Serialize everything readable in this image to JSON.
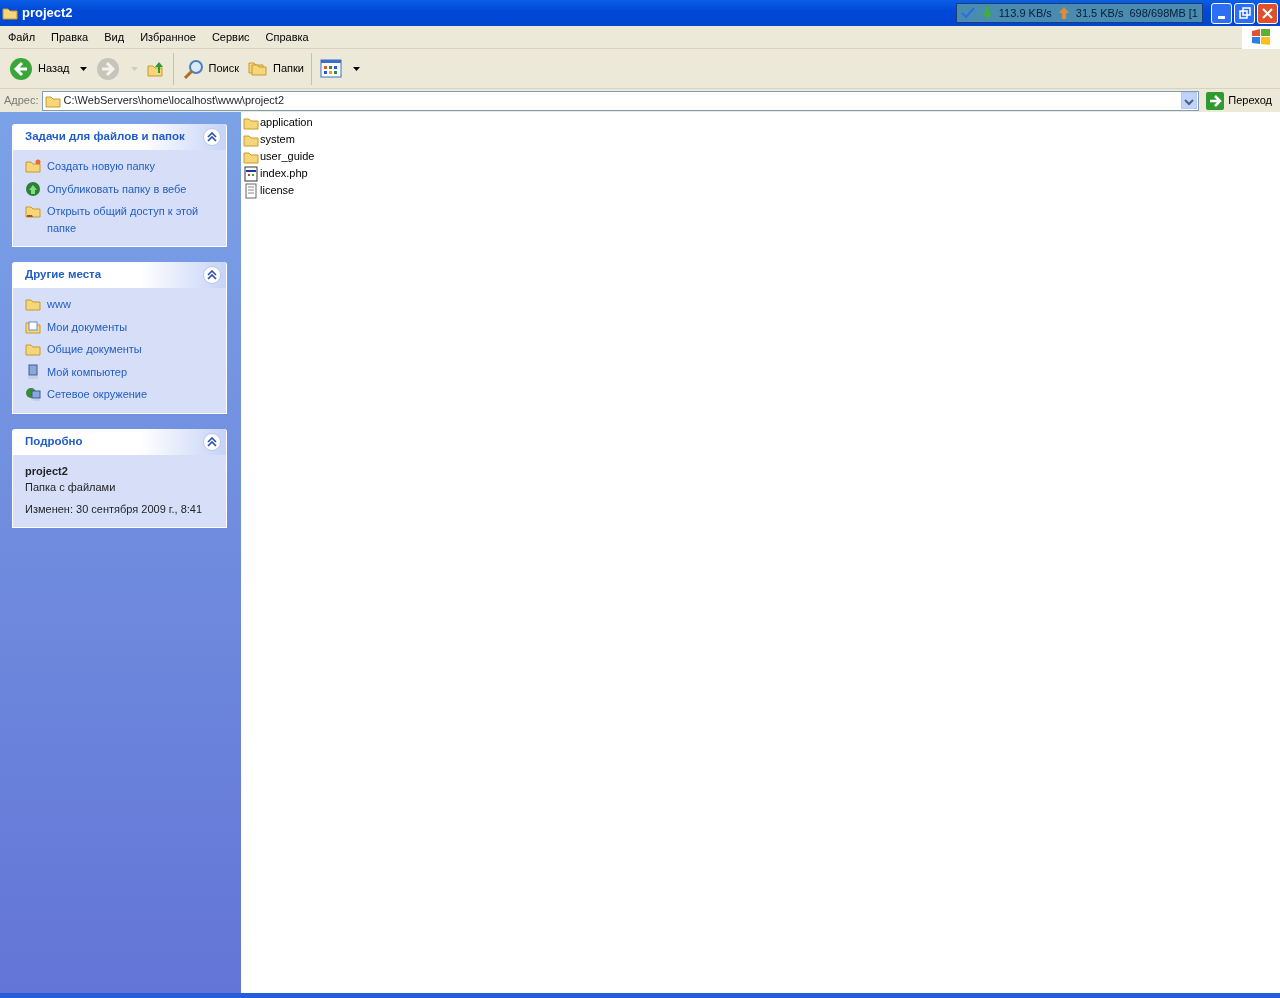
{
  "window": {
    "title": "project2"
  },
  "title_widget": {
    "download": "113.9 KB/s",
    "upload": "31.5 KB/s",
    "memory": "698/698MB [1"
  },
  "menu": [
    "Файл",
    "Правка",
    "Вид",
    "Избранное",
    "Сервис",
    "Справка"
  ],
  "toolbar": [
    {
      "kind": "back",
      "label": "Назад",
      "disabled": false
    },
    {
      "kind": "forward",
      "disabled": true
    },
    {
      "kind": "up",
      "disabled": false
    },
    {
      "kind": "search",
      "label": "Поиск",
      "disabled": false
    },
    {
      "kind": "folders",
      "label": "Папки",
      "disabled": false
    },
    {
      "kind": "views",
      "disabled": false
    }
  ],
  "address": {
    "label": "Адрес:",
    "value": "C:\\WebServers\\home\\localhost\\www\\project2",
    "go": "Переход"
  },
  "panels": [
    {
      "title": "Задачи для файлов и папок",
      "expanded": true,
      "items": [
        {
          "kind": "new-folder",
          "label": "Создать новую папку"
        },
        {
          "kind": "publish",
          "label": "Опубликовать папку в вебе"
        },
        {
          "kind": "share",
          "label": "Открыть общий доступ к этой папке"
        }
      ]
    },
    {
      "title": "Другие места",
      "expanded": true,
      "items": [
        {
          "kind": "folder",
          "label": "www"
        },
        {
          "kind": "documents",
          "label": "Мои документы"
        },
        {
          "kind": "folder",
          "label": "Общие документы"
        },
        {
          "kind": "computer",
          "label": "Мой компьютер"
        },
        {
          "kind": "network",
          "label": "Сетевое окружение"
        }
      ]
    },
    {
      "title": "Подробно",
      "expanded": true,
      "details": {
        "name": "project2",
        "type": "Папка с файлами",
        "modified": "Изменен: 30 сентября 2009 г., 8:41"
      }
    }
  ],
  "files": [
    {
      "kind": "folder",
      "name": "application"
    },
    {
      "kind": "folder",
      "name": "system"
    },
    {
      "kind": "folder",
      "name": "user_guide"
    },
    {
      "kind": "php",
      "name": "index.php"
    },
    {
      "kind": "text",
      "name": "license"
    }
  ]
}
